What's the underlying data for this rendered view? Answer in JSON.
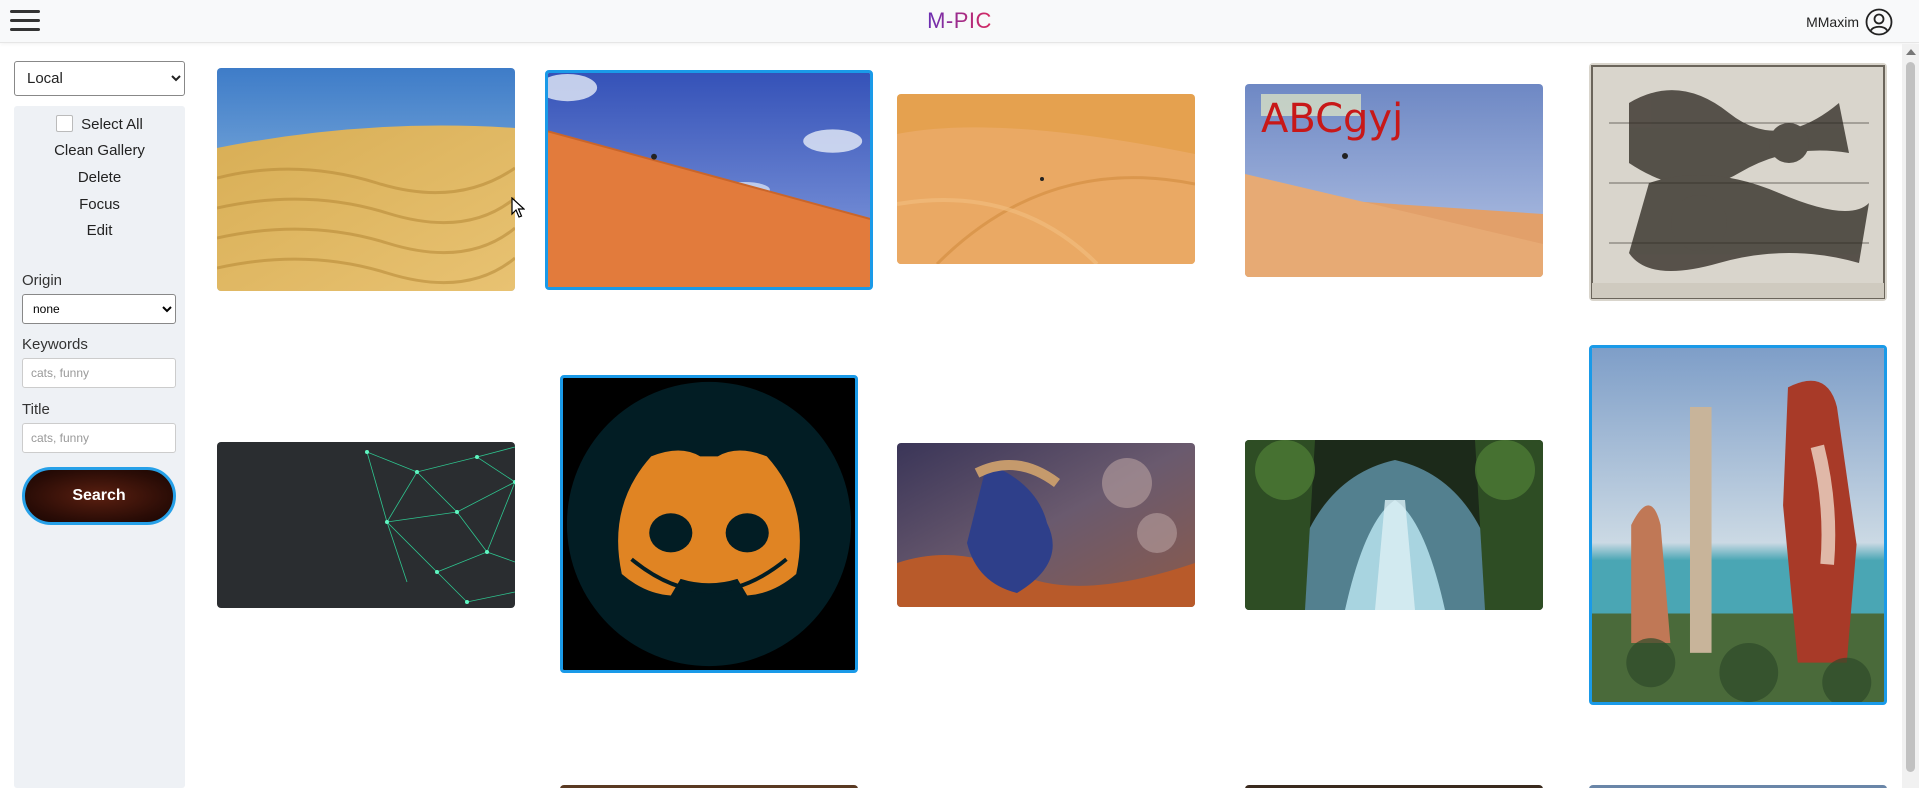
{
  "header": {
    "brand": "M-PIC",
    "username": "MMaxim",
    "menu_icon": "hamburger-menu-icon",
    "user_icon": "user-circle-icon"
  },
  "sidebar": {
    "source_select": {
      "value": "Local",
      "options": [
        "Local"
      ]
    },
    "actions": {
      "select_all": "Select All",
      "clean_gallery": "Clean Gallery",
      "delete": "Delete",
      "focus": "Focus",
      "edit": "Edit"
    },
    "search": {
      "origin_label": "Origin",
      "origin_value": "none",
      "keywords_label": "Keywords",
      "keywords_placeholder": "cats, funny",
      "title_label": "Title",
      "title_placeholder": "cats, funny",
      "search_button": "Search"
    }
  },
  "gallery": {
    "images": [
      {
        "name": "sand-dunes-image",
        "selected": false
      },
      {
        "name": "dune-climber-image",
        "selected": true
      },
      {
        "name": "desert-walker-image",
        "selected": false
      },
      {
        "name": "dune-climber-text-image",
        "selected": false,
        "overlay_text": "ABCgyj"
      },
      {
        "name": "dragon-engraving-image",
        "selected": false
      },
      {
        "name": "network-lines-image",
        "selected": false
      },
      {
        "name": "discord-logo-image",
        "selected": true
      },
      {
        "name": "fallen-figure-painting-image",
        "selected": false
      },
      {
        "name": "forest-waterfall-image",
        "selected": false
      },
      {
        "name": "surreal-figures-painting-image",
        "selected": true
      }
    ]
  },
  "colors": {
    "accent": "#1a9ae8",
    "brand_start": "#6a2fb4",
    "brand_end": "#d6285f",
    "sidebar_bg": "#eef1f5"
  }
}
